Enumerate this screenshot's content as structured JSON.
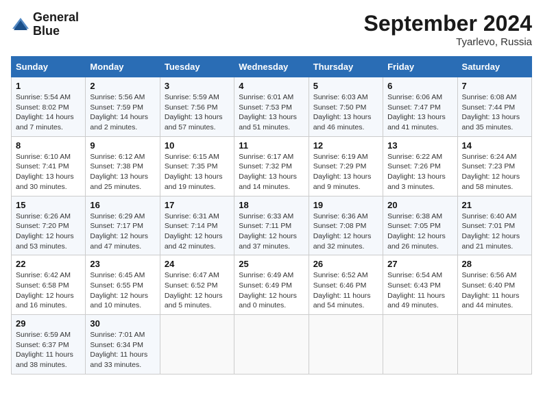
{
  "header": {
    "logo_line1": "General",
    "logo_line2": "Blue",
    "month": "September 2024",
    "location": "Tyarlevo, Russia"
  },
  "weekdays": [
    "Sunday",
    "Monday",
    "Tuesday",
    "Wednesday",
    "Thursday",
    "Friday",
    "Saturday"
  ],
  "weeks": [
    [
      {
        "day": "1",
        "info": "Sunrise: 5:54 AM\nSunset: 8:02 PM\nDaylight: 14 hours\nand 7 minutes."
      },
      {
        "day": "2",
        "info": "Sunrise: 5:56 AM\nSunset: 7:59 PM\nDaylight: 14 hours\nand 2 minutes."
      },
      {
        "day": "3",
        "info": "Sunrise: 5:59 AM\nSunset: 7:56 PM\nDaylight: 13 hours\nand 57 minutes."
      },
      {
        "day": "4",
        "info": "Sunrise: 6:01 AM\nSunset: 7:53 PM\nDaylight: 13 hours\nand 51 minutes."
      },
      {
        "day": "5",
        "info": "Sunrise: 6:03 AM\nSunset: 7:50 PM\nDaylight: 13 hours\nand 46 minutes."
      },
      {
        "day": "6",
        "info": "Sunrise: 6:06 AM\nSunset: 7:47 PM\nDaylight: 13 hours\nand 41 minutes."
      },
      {
        "day": "7",
        "info": "Sunrise: 6:08 AM\nSunset: 7:44 PM\nDaylight: 13 hours\nand 35 minutes."
      }
    ],
    [
      {
        "day": "8",
        "info": "Sunrise: 6:10 AM\nSunset: 7:41 PM\nDaylight: 13 hours\nand 30 minutes."
      },
      {
        "day": "9",
        "info": "Sunrise: 6:12 AM\nSunset: 7:38 PM\nDaylight: 13 hours\nand 25 minutes."
      },
      {
        "day": "10",
        "info": "Sunrise: 6:15 AM\nSunset: 7:35 PM\nDaylight: 13 hours\nand 19 minutes."
      },
      {
        "day": "11",
        "info": "Sunrise: 6:17 AM\nSunset: 7:32 PM\nDaylight: 13 hours\nand 14 minutes."
      },
      {
        "day": "12",
        "info": "Sunrise: 6:19 AM\nSunset: 7:29 PM\nDaylight: 13 hours\nand 9 minutes."
      },
      {
        "day": "13",
        "info": "Sunrise: 6:22 AM\nSunset: 7:26 PM\nDaylight: 13 hours\nand 3 minutes."
      },
      {
        "day": "14",
        "info": "Sunrise: 6:24 AM\nSunset: 7:23 PM\nDaylight: 12 hours\nand 58 minutes."
      }
    ],
    [
      {
        "day": "15",
        "info": "Sunrise: 6:26 AM\nSunset: 7:20 PM\nDaylight: 12 hours\nand 53 minutes."
      },
      {
        "day": "16",
        "info": "Sunrise: 6:29 AM\nSunset: 7:17 PM\nDaylight: 12 hours\nand 47 minutes."
      },
      {
        "day": "17",
        "info": "Sunrise: 6:31 AM\nSunset: 7:14 PM\nDaylight: 12 hours\nand 42 minutes."
      },
      {
        "day": "18",
        "info": "Sunrise: 6:33 AM\nSunset: 7:11 PM\nDaylight: 12 hours\nand 37 minutes."
      },
      {
        "day": "19",
        "info": "Sunrise: 6:36 AM\nSunset: 7:08 PM\nDaylight: 12 hours\nand 32 minutes."
      },
      {
        "day": "20",
        "info": "Sunrise: 6:38 AM\nSunset: 7:05 PM\nDaylight: 12 hours\nand 26 minutes."
      },
      {
        "day": "21",
        "info": "Sunrise: 6:40 AM\nSunset: 7:01 PM\nDaylight: 12 hours\nand 21 minutes."
      }
    ],
    [
      {
        "day": "22",
        "info": "Sunrise: 6:42 AM\nSunset: 6:58 PM\nDaylight: 12 hours\nand 16 minutes."
      },
      {
        "day": "23",
        "info": "Sunrise: 6:45 AM\nSunset: 6:55 PM\nDaylight: 12 hours\nand 10 minutes."
      },
      {
        "day": "24",
        "info": "Sunrise: 6:47 AM\nSunset: 6:52 PM\nDaylight: 12 hours\nand 5 minutes."
      },
      {
        "day": "25",
        "info": "Sunrise: 6:49 AM\nSunset: 6:49 PM\nDaylight: 12 hours\nand 0 minutes."
      },
      {
        "day": "26",
        "info": "Sunrise: 6:52 AM\nSunset: 6:46 PM\nDaylight: 11 hours\nand 54 minutes."
      },
      {
        "day": "27",
        "info": "Sunrise: 6:54 AM\nSunset: 6:43 PM\nDaylight: 11 hours\nand 49 minutes."
      },
      {
        "day": "28",
        "info": "Sunrise: 6:56 AM\nSunset: 6:40 PM\nDaylight: 11 hours\nand 44 minutes."
      }
    ],
    [
      {
        "day": "29",
        "info": "Sunrise: 6:59 AM\nSunset: 6:37 PM\nDaylight: 11 hours\nand 38 minutes."
      },
      {
        "day": "30",
        "info": "Sunrise: 7:01 AM\nSunset: 6:34 PM\nDaylight: 11 hours\nand 33 minutes."
      },
      {
        "day": "",
        "info": ""
      },
      {
        "day": "",
        "info": ""
      },
      {
        "day": "",
        "info": ""
      },
      {
        "day": "",
        "info": ""
      },
      {
        "day": "",
        "info": ""
      }
    ]
  ]
}
